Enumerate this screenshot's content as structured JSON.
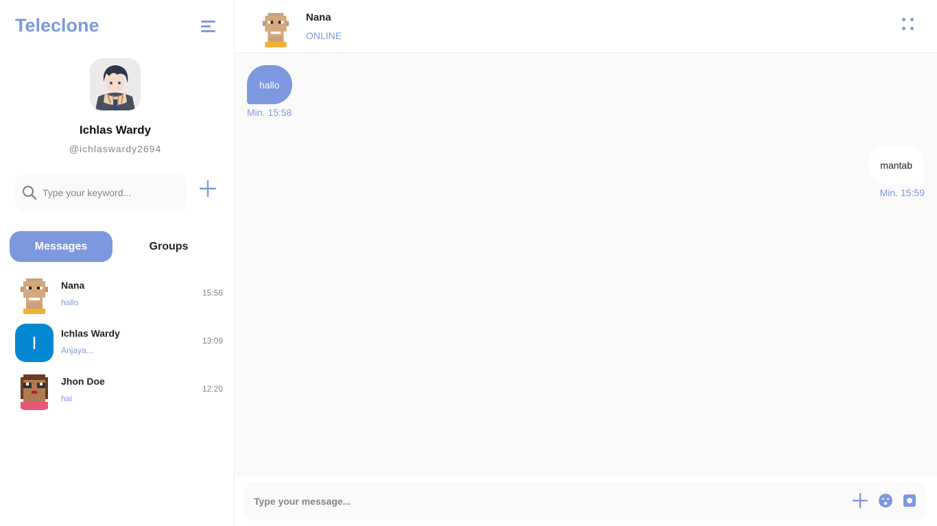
{
  "app": {
    "title": "Teleclone"
  },
  "profile": {
    "name": "Ichlas Wardy",
    "username": "@ichlaswardy2694"
  },
  "search": {
    "placeholder": "Type your keyword..."
  },
  "tabs": [
    {
      "label": "Messages",
      "active": true
    },
    {
      "label": "Groups",
      "active": false
    }
  ],
  "chats": [
    {
      "name": "Nana",
      "preview": "hallo",
      "time": "15:58",
      "avatar": "pixel-avatar-bald"
    },
    {
      "name": "Ichlas Wardy",
      "preview": "Anjaya...",
      "time": "13:09",
      "avatar_letter": "I"
    },
    {
      "name": "Jhon Doe",
      "preview": "hai",
      "time": "12:20",
      "avatar": "pixel-avatar-glasses"
    }
  ],
  "conversation": {
    "contact_name": "Nana",
    "contact_status": "ONLINE",
    "messages": [
      {
        "direction": "incoming",
        "text": "hallo",
        "time": "Min. 15:58"
      },
      {
        "direction": "outgoing",
        "text": "mantab",
        "time": "Min. 15:59"
      }
    ]
  },
  "composer": {
    "placeholder": "Type your message..."
  },
  "colors": {
    "accent": "#7e98df",
    "background": "#fafafa",
    "letter_avatar": "#0288d1"
  },
  "icons": [
    "menu-icon",
    "search-icon",
    "plus-icon",
    "more-dots-icon",
    "emoji-icon",
    "camera-icon"
  ]
}
